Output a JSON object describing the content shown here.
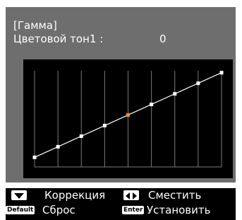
{
  "header": {
    "title": "[Гамма]",
    "setting_label": "Цветовой тон1 :",
    "setting_value": "0"
  },
  "gamma_graph": {
    "point_values": [
      0.1,
      0.21,
      0.32,
      0.43,
      0.54,
      0.65,
      0.76,
      0.87,
      0.98
    ],
    "selected_point_index": 4,
    "grid_divisions": 8,
    "colors": {
      "background": "#000000",
      "grid": "#7a7a7a",
      "curve": "#ffffff",
      "point": "#ffffff",
      "selected_point": "#f0901c"
    }
  },
  "footer": {
    "correction_icon": "up-down-arrows-icon",
    "correction_label": "Коррекция",
    "shift_icon": "left-right-arrows-icon",
    "shift_label": "Сместить",
    "reset_key": "Default",
    "reset_label": "Сброс",
    "enter_key": "Enter",
    "enter_label": "Установить"
  }
}
